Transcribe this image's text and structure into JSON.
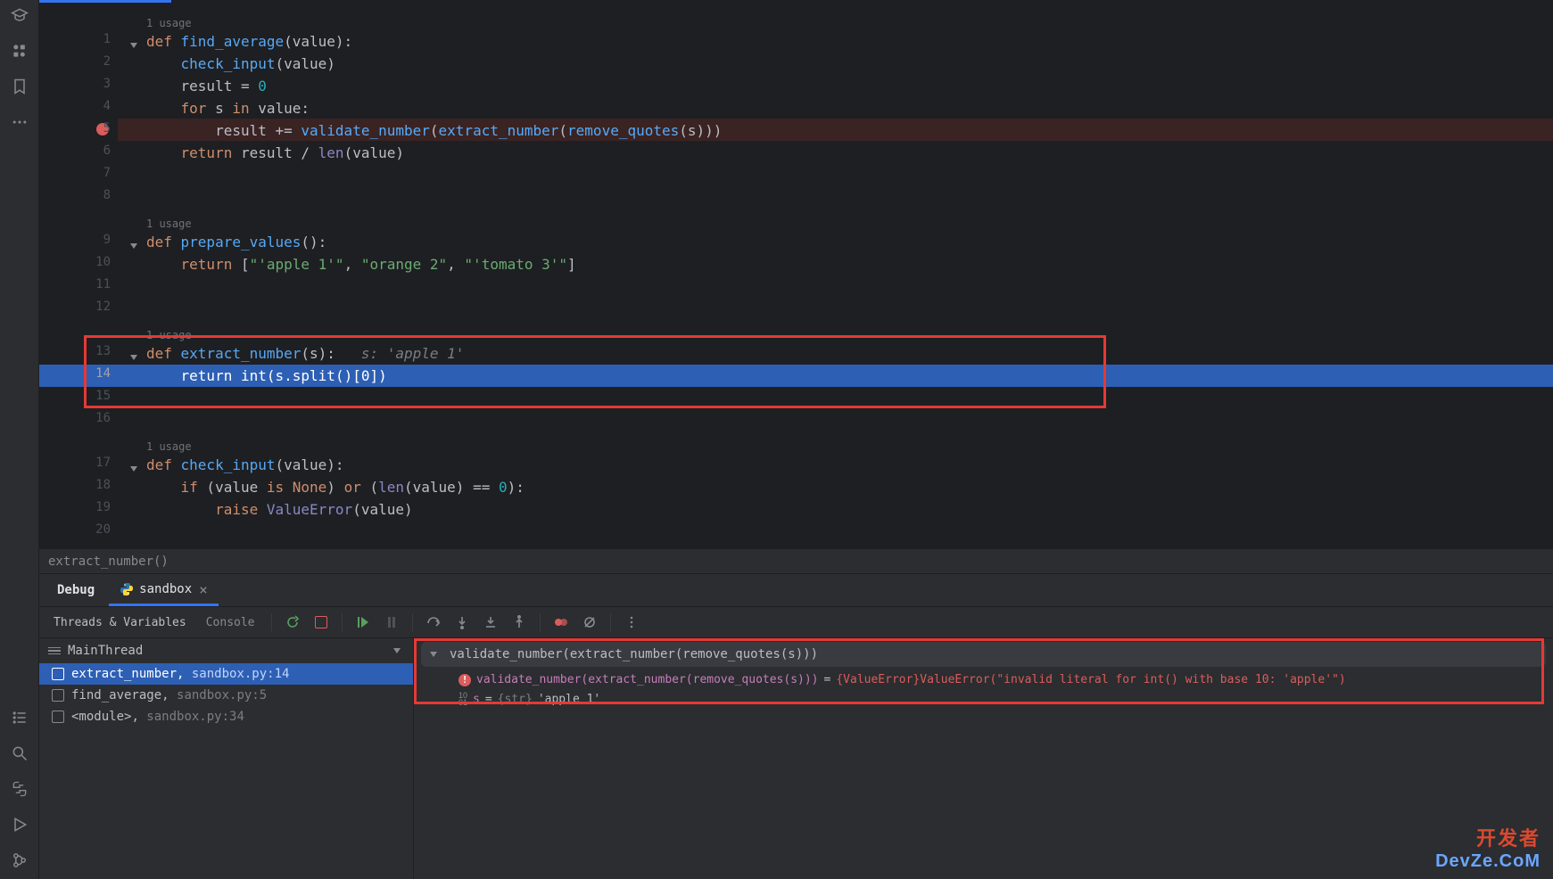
{
  "left_rail": {
    "icons": [
      "graduation-cap",
      "shapes",
      "bookmark",
      "more",
      "list",
      "search",
      "python",
      "run",
      "git"
    ]
  },
  "editor": {
    "usages_text": "1 usage",
    "lines": {
      "l1": {
        "tokens": [
          "def ",
          "find_average",
          "(value):"
        ]
      },
      "l2": {
        "tokens": [
          "    ",
          "check_input",
          "(value)"
        ]
      },
      "l3": {
        "tokens": [
          "    result = ",
          "0"
        ]
      },
      "l4": {
        "tokens": [
          "    ",
          "for",
          " s ",
          "in",
          " value:"
        ]
      },
      "l5": {
        "tokens": [
          "        result += ",
          "validate_number",
          "(",
          "extract_number",
          "(",
          "remove_quotes",
          "(s)))"
        ]
      },
      "l6": {
        "tokens": [
          "    ",
          "return",
          " result / ",
          "len",
          "(value)"
        ]
      },
      "l9": {
        "tokens": [
          "def ",
          "prepare_values",
          "():"
        ]
      },
      "l10": {
        "tokens": [
          "    ",
          "return",
          " [",
          "\"'apple 1'\"",
          ", ",
          "\"orange 2\"",
          ", ",
          "\"'tomato 3'\"",
          "]"
        ]
      },
      "l13": {
        "fn": "extract_number",
        "hint": "s: 'apple 1'"
      },
      "l14": {
        "tokens": [
          "    ",
          "return ",
          "int",
          "(s.split()[",
          "0",
          "])"
        ]
      },
      "l17": {
        "tokens": [
          "def ",
          "check_input",
          "(value):"
        ]
      },
      "l18": {
        "tokens": [
          "    ",
          "if",
          " (value ",
          "is None",
          ") ",
          "or",
          " (",
          "len",
          "(value) == ",
          "0",
          "):"
        ]
      },
      "l19": {
        "tokens": [
          "        ",
          "raise ",
          "ValueError",
          "(value)"
        ]
      }
    },
    "line_numbers": [
      "1",
      "2",
      "3",
      "4",
      "5",
      "6",
      "7",
      "8",
      "9",
      "10",
      "11",
      "12",
      "13",
      "14",
      "15",
      "16",
      "17",
      "18",
      "19",
      "20"
    ]
  },
  "breadcrumb": {
    "text": "extract_number()"
  },
  "debug": {
    "title": "Debug",
    "file_tab": "sandbox",
    "toolbar_tabs": [
      "Threads & Variables",
      "Console"
    ],
    "thread": "MainThread",
    "frames": [
      {
        "fn": "extract_number",
        "loc": "sandbox.py:14"
      },
      {
        "fn": "find_average",
        "loc": "sandbox.py:5"
      },
      {
        "fn": "<module>",
        "loc": "sandbox.py:34"
      }
    ],
    "eval_expr": "validate_number(extract_number(remove_quotes(s)))",
    "error_var": {
      "expr": "validate_number(extract_number(remove_quotes(s)))",
      "msg": "{ValueError}ValueError(\"invalid literal for int() with base 10: 'apple'\")"
    },
    "var_s": {
      "name": "s",
      "type": "{str}",
      "value": "'apple 1'"
    }
  },
  "watermark": {
    "l1": "开发者",
    "l2": "DevZe.CoM"
  }
}
